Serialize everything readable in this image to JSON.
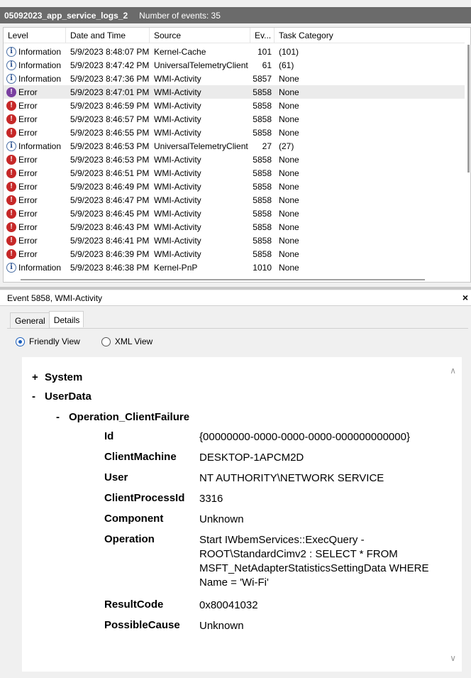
{
  "titlebar": {
    "title": "05092023_app_service_logs_2",
    "count": "Number of events: 35"
  },
  "columns": {
    "level": "Level",
    "date": "Date and Time",
    "source": "Source",
    "event_id": "Ev...",
    "task": "Task Category"
  },
  "events": [
    {
      "level": "Information",
      "date": "5/9/2023 8:48:07 PM",
      "source": "Kernel-Cache",
      "id": "101",
      "task": "(101)"
    },
    {
      "level": "Information",
      "date": "5/9/2023 8:47:42 PM",
      "source": "UniversalTelemetryClient",
      "id": "61",
      "task": "(61)"
    },
    {
      "level": "Information",
      "date": "5/9/2023 8:47:36 PM",
      "source": "WMI-Activity",
      "id": "5857",
      "task": "None"
    },
    {
      "level": "Error",
      "date": "5/9/2023 8:47:01 PM",
      "source": "WMI-Activity",
      "id": "5858",
      "task": "None"
    },
    {
      "level": "Error",
      "date": "5/9/2023 8:46:59 PM",
      "source": "WMI-Activity",
      "id": "5858",
      "task": "None"
    },
    {
      "level": "Error",
      "date": "5/9/2023 8:46:57 PM",
      "source": "WMI-Activity",
      "id": "5858",
      "task": "None"
    },
    {
      "level": "Error",
      "date": "5/9/2023 8:46:55 PM",
      "source": "WMI-Activity",
      "id": "5858",
      "task": "None"
    },
    {
      "level": "Information",
      "date": "5/9/2023 8:46:53 PM",
      "source": "UniversalTelemetryClient",
      "id": "27",
      "task": "(27)"
    },
    {
      "level": "Error",
      "date": "5/9/2023 8:46:53 PM",
      "source": "WMI-Activity",
      "id": "5858",
      "task": "None"
    },
    {
      "level": "Error",
      "date": "5/9/2023 8:46:51 PM",
      "source": "WMI-Activity",
      "id": "5858",
      "task": "None"
    },
    {
      "level": "Error",
      "date": "5/9/2023 8:46:49 PM",
      "source": "WMI-Activity",
      "id": "5858",
      "task": "None"
    },
    {
      "level": "Error",
      "date": "5/9/2023 8:46:47 PM",
      "source": "WMI-Activity",
      "id": "5858",
      "task": "None"
    },
    {
      "level": "Error",
      "date": "5/9/2023 8:46:45 PM",
      "source": "WMI-Activity",
      "id": "5858",
      "task": "None"
    },
    {
      "level": "Error",
      "date": "5/9/2023 8:46:43 PM",
      "source": "WMI-Activity",
      "id": "5858",
      "task": "None"
    },
    {
      "level": "Error",
      "date": "5/9/2023 8:46:41 PM",
      "source": "WMI-Activity",
      "id": "5858",
      "task": "None"
    },
    {
      "level": "Error",
      "date": "5/9/2023 8:46:39 PM",
      "source": "WMI-Activity",
      "id": "5858",
      "task": "None"
    },
    {
      "level": "Information",
      "date": "5/9/2023 8:46:38 PM",
      "source": "Kernel-PnP",
      "id": "1010",
      "task": "None"
    }
  ],
  "selected_row": 3,
  "detail": {
    "header": "Event 5858, WMI-Activity",
    "close": "×",
    "tabs": [
      "General",
      "Details"
    ],
    "views": [
      "Friendly View",
      "XML View"
    ],
    "tree": {
      "system_sign": "+",
      "system": "System",
      "userdata_sign": "-",
      "userdata": "UserData",
      "op_sign": "-",
      "op": "Operation_ClientFailure"
    },
    "fields": [
      {
        "k": "Id",
        "v": "{00000000-0000-0000-0000-000000000000}"
      },
      {
        "k": "ClientMachine",
        "v": "DESKTOP-1APCM2D"
      },
      {
        "k": "User",
        "v": "NT AUTHORITY\\NETWORK SERVICE"
      },
      {
        "k": "ClientProcessId",
        "v": "3316"
      },
      {
        "k": "Component",
        "v": "Unknown"
      },
      {
        "k": "Operation",
        "v": "Start IWbemServices::ExecQuery - ROOT\\StandardCimv2 : SELECT * FROM MSFT_NetAdapterStatisticsSettingData WHERE Name = 'Wi-Fi'"
      },
      {
        "k": "ResultCode",
        "v": "0x80041032"
      },
      {
        "k": "PossibleCause",
        "v": "Unknown"
      }
    ]
  }
}
